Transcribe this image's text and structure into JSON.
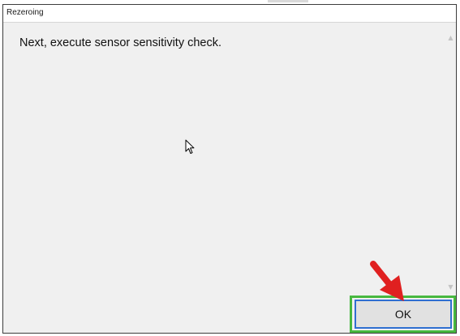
{
  "window": {
    "title": "Rezeroing"
  },
  "content": {
    "message": "Next, execute sensor sensitivity check."
  },
  "buttons": {
    "ok_label": "OK"
  },
  "colors": {
    "highlight_border": "#47b83f",
    "button_focus_border": "#2f6fd1",
    "annotation_arrow": "#e02020",
    "dialog_background": "#f0f0f0"
  },
  "icons": {
    "cursor": "mouse-pointer-icon",
    "annotation": "red-arrow-icon",
    "scroll_up": "chevron-up-icon",
    "scroll_down": "chevron-down-icon"
  }
}
